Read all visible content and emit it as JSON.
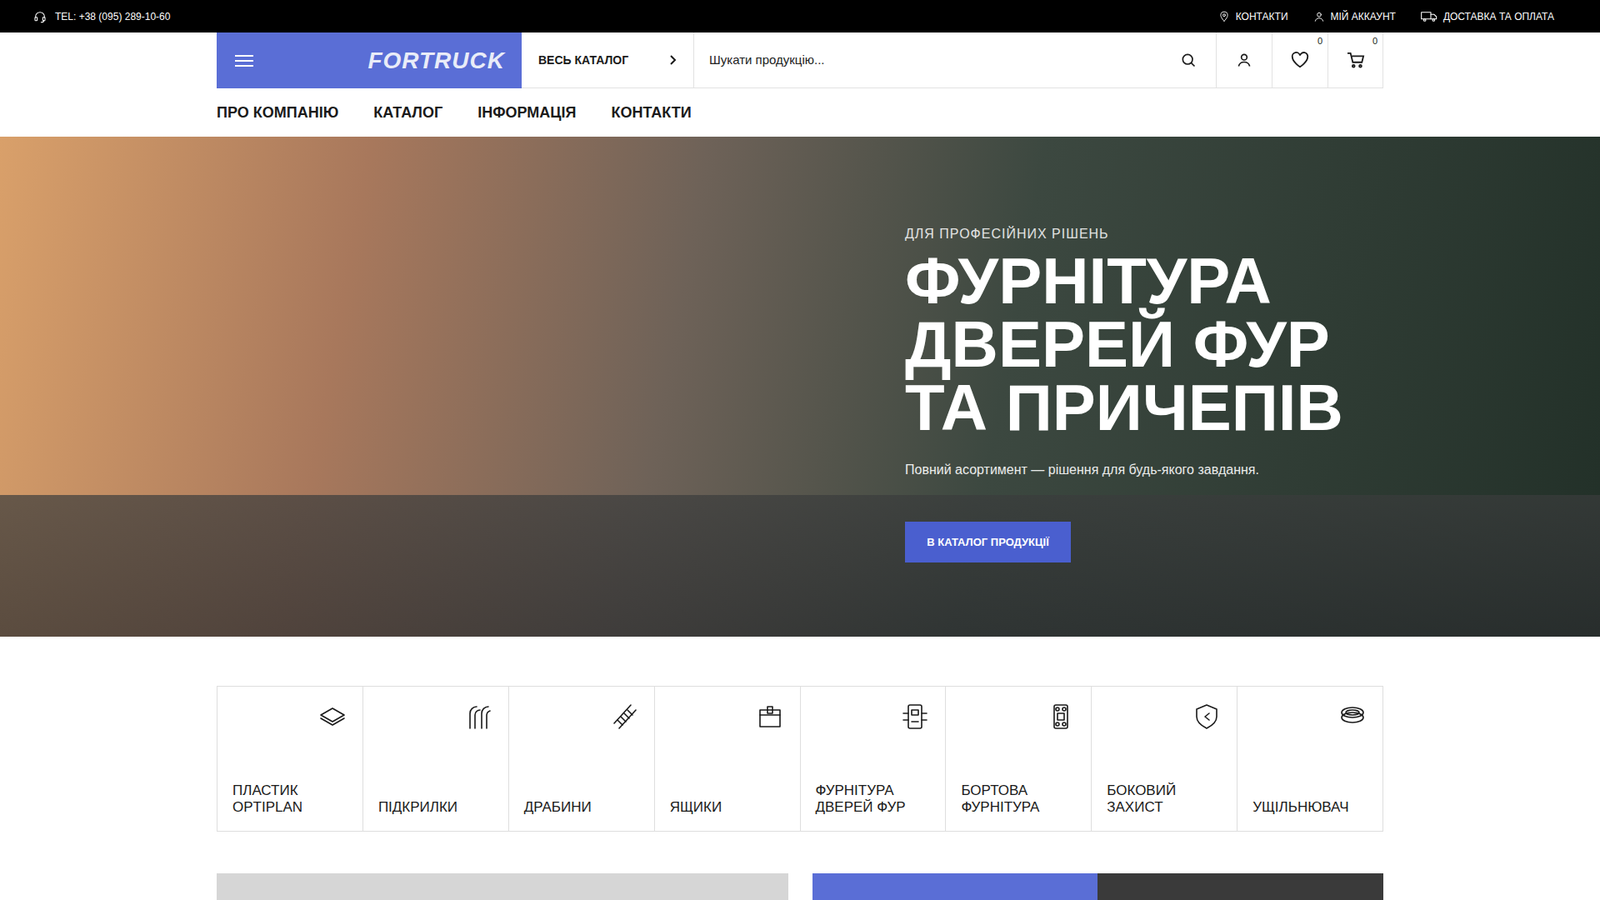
{
  "topbar": {
    "phone": "TEL: +38 (095) 289-10-60",
    "links": [
      "КОНТАКТИ",
      "МІЙ АККАУНТ",
      "ДОСТАВКА ТА ОПЛАТА"
    ]
  },
  "header": {
    "logo": "FORTRUCK",
    "catalog_button": "ВЕСЬ КАТАЛОГ",
    "search": {
      "placeholder": "Шукати продукцію..."
    },
    "wishlist_count": "0",
    "cart_count": "0"
  },
  "nav": [
    "ПРО КОМПАНІЮ",
    "КАТАЛОГ",
    "ІНФОРМАЦІЯ",
    "КОНТАКТИ"
  ],
  "hero": {
    "eyebrow": "ДЛЯ ПРОФЕСІЙНИХ РІШЕНЬ",
    "title": [
      "ФУРНІТУРА",
      "ДВЕРЕЙ ФУР",
      "ТА ПРИЧЕПІВ"
    ],
    "subtitle": "Повний асортимент — рішення для будь-якого завдання.",
    "button": "В КАТАЛОГ ПРОДУКЦІЇ"
  },
  "categories": [
    {
      "label": "ПЛАСТИК OPTIPLAN"
    },
    {
      "label": "ПІДКРИЛКИ"
    },
    {
      "label": "ДРАБИНИ"
    },
    {
      "label": "ЯЩИКИ"
    },
    {
      "label": "ФУРНІТУРА ДВЕРЕЙ ФУР"
    },
    {
      "label": "БОРТОВА ФУРНІТУРА"
    },
    {
      "label": "БОКОВИЙ ЗАХИСТ"
    },
    {
      "label": "УЩІЛЬНЮВАЧ"
    }
  ]
}
